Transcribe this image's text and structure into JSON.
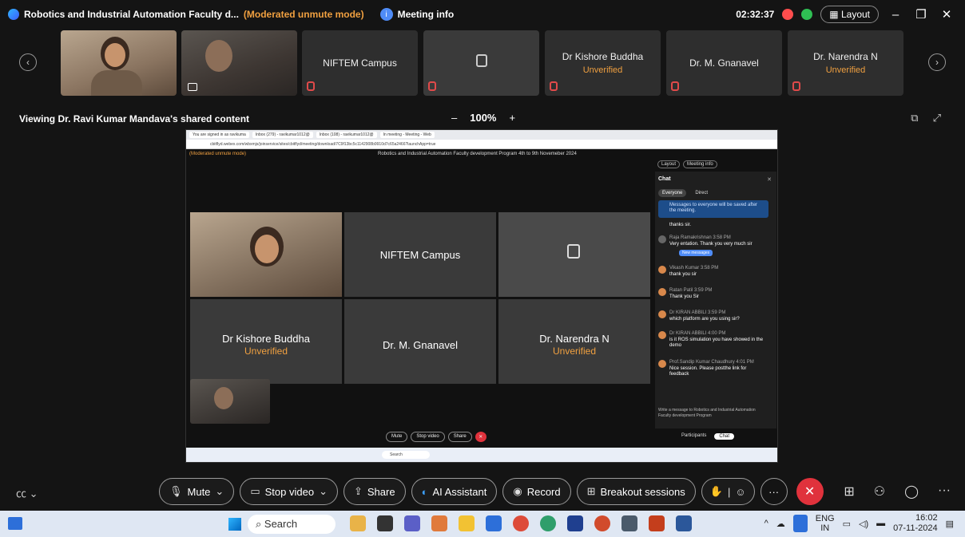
{
  "titlebar": {
    "title": "Robotics and Industrial Automation Faculty d...",
    "mode": "(Moderated unmute mode)",
    "meeting_info": "Meeting info",
    "time": "02:32:37",
    "layout": "Layout"
  },
  "participants": {
    "tiles": [
      {
        "name": ""
      },
      {
        "name": ""
      },
      {
        "name": "NIFTEM Campus"
      },
      {
        "name": ""
      },
      {
        "name": "Dr Kishore Buddha",
        "status": "Unverified"
      },
      {
        "name": "Dr. M. Gnanavel"
      },
      {
        "name": "Dr. Narendra N",
        "status": "Unverified"
      }
    ]
  },
  "viewbar": {
    "label": "Viewing Dr. Ravi Kumar Mandava's shared content",
    "zoom": "100%"
  },
  "shared": {
    "browser_tabs": [
      "You are signed in as ravikuma",
      "Inbox (279) - ravikumar1012@",
      "Inbox (108) - ravikumar1012@",
      "In meeting - Meeting - Web"
    ],
    "address": "cbitflyd.webex.com/wbxmjs/joinservice/sites/cbitflyd/meeting/download/7C9f13bc5c1142908b9910d7c65a2466?launchApp=true",
    "mode": "(Moderated unmute mode)",
    "meeting_title": "Robotics and Industrial Automation Faculty development Program 4th to 9th Novemeber 2024",
    "layout": "Layout",
    "meeting_info": "Meeting info",
    "tiles": [
      {
        "name": ""
      },
      {
        "name": "NIFTEM Campus"
      },
      {
        "name": ""
      },
      {
        "name": "Dr Kishore Buddha",
        "status": "Unverified"
      },
      {
        "name": "Dr. M. Gnanavel"
      },
      {
        "name": "Dr. Narendra N",
        "status": "Unverified"
      }
    ],
    "toolbar": {
      "mute": "Mute",
      "stop_video": "Stop video",
      "share": "Share"
    },
    "participants": "Participants",
    "chat": "Chat",
    "search": "Search",
    "chat_panel": {
      "title": "Chat",
      "tab_everyone": "Everyone",
      "tab_direct": "Direct",
      "notice": "Messages to everyone will be saved after the meeting.",
      "new_messages": "New messages",
      "messages": [
        {
          "who": "",
          "text": "thanks sir."
        },
        {
          "who": "Raja Ramakrishnan  3:58 PM",
          "text": "Very         entation. Thank you very much sir"
        },
        {
          "who": "Vikash Kumar  3:58 PM",
          "text": "thank you sir"
        },
        {
          "who": "Ratan Patil  3:59 PM",
          "text": "Thank you Sir"
        },
        {
          "who": "Dr KIRAN ABBILI  3:59 PM",
          "text": "which platform are you using sir?"
        },
        {
          "who": "Dr KIRAN ABBILI  4:00 PM",
          "text": "is it ROS simulation you have showed in the demo"
        },
        {
          "who": "Prof.Sandip Kumar Chaudhury  4:01 PM",
          "text": "Nice session. Please postthe link for feedback"
        }
      ],
      "input_placeholder": "Write a message to Robotics and Industrial Automation Faculty development Program"
    }
  },
  "toolbar": {
    "mute": "Mute",
    "stop_video": "Stop video",
    "share": "Share",
    "ai": "AI Assistant",
    "record": "Record",
    "breakout": "Breakout sessions"
  },
  "taskbar": {
    "search": "Search",
    "lang1": "ENG",
    "lang2": "IN",
    "time": "16:02",
    "date": "07-11-2024"
  }
}
